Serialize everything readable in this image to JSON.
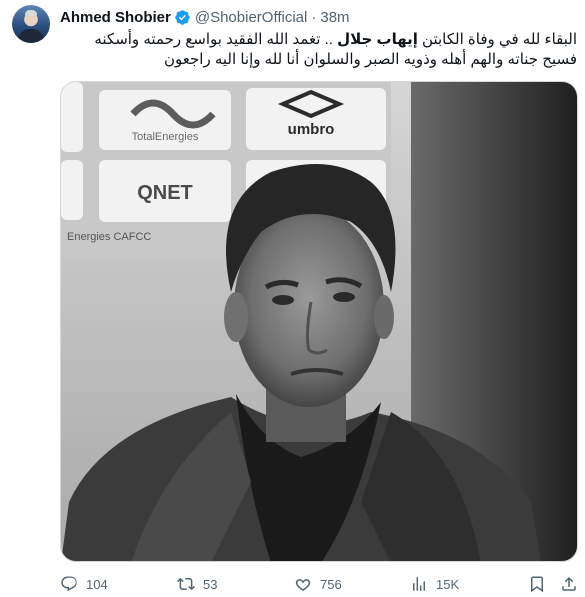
{
  "author": {
    "name": "Ahmed Shobier",
    "handle": "@ShobierOfficial",
    "separator": "·",
    "time": "38m"
  },
  "tweet": {
    "part1": "البقاء لله في وفاة الكابتن",
    "bold": "إيهاب جلال",
    "part2": ".. تغمد الله الفقيد بواسع رحمته وأسكنه فسيح جناته والهم أهله وذويه الصبر والسلوان أنا لله وإنا اليه راجعون"
  },
  "media": {
    "sponsor_1": "TotalEnergies",
    "sponsor_2": "umbro",
    "sponsor_3": "QNET",
    "sponsor_4": "Energies CAFCC"
  },
  "actions": {
    "replies": "104",
    "reposts": "53",
    "likes": "756",
    "views": "15K"
  },
  "colors": {
    "text": "#0f1419",
    "secondary": "#536471",
    "verified": "#1d9bf0"
  }
}
